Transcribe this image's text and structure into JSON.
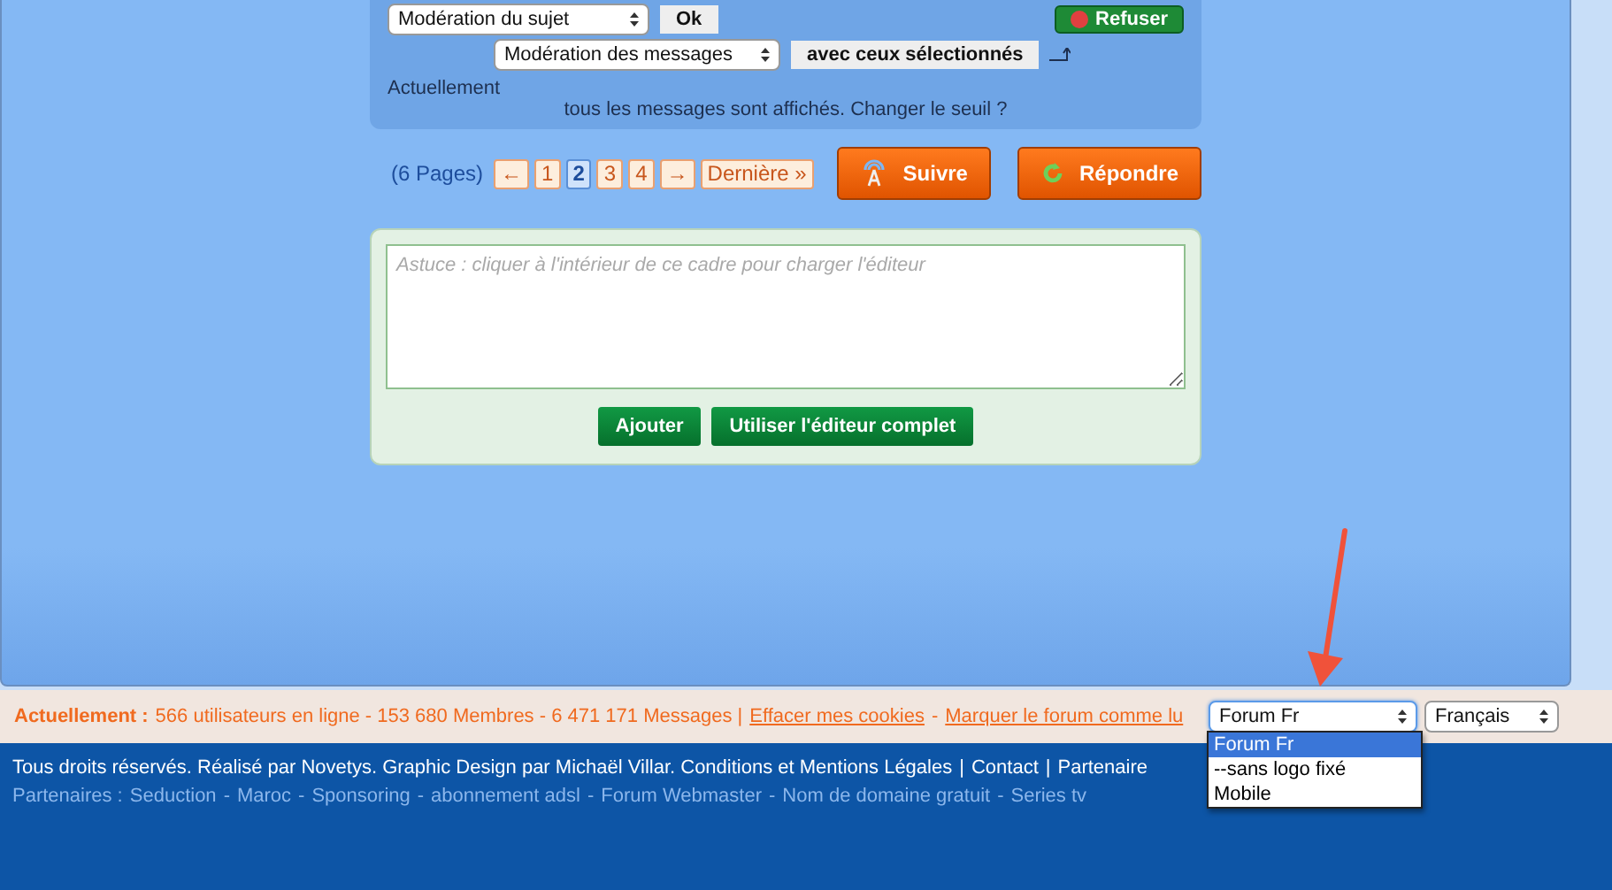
{
  "moderation": {
    "topic_select": "Modération du sujet",
    "ok": "Ok",
    "messages_select": "Modération des messages",
    "selected_action": "avec ceux sélectionnés",
    "refuse": "Refuser",
    "status_label": "Actuellement",
    "status_text": "tous les messages sont affichés. Changer le seuil ?"
  },
  "pagination": {
    "label": "(6 Pages)",
    "items": [
      {
        "label": "←",
        "selected": false
      },
      {
        "label": "1",
        "selected": false
      },
      {
        "label": "2",
        "selected": true
      },
      {
        "label": "3",
        "selected": false
      },
      {
        "label": "4",
        "selected": false
      },
      {
        "label": "→",
        "selected": false
      },
      {
        "label": "Dernière »",
        "selected": false
      }
    ]
  },
  "actions": [
    {
      "kind": "follow",
      "label": "Suivre"
    },
    {
      "kind": "reply",
      "label": "Répondre"
    }
  ],
  "quick_reply": {
    "placeholder": "Astuce : cliquer à l'intérieur de ce cadre pour charger l'éditeur",
    "buttons": [
      "Ajouter",
      "Utiliser l'éditeur complet"
    ]
  },
  "online_bar": {
    "label": "Actuellement :",
    "stats": "566 utilisateurs en ligne - 153 680 Membres - 6 471 171 Messages |",
    "links": [
      "Effacer mes cookies",
      "Marquer le forum comme lu"
    ],
    "separator": "-",
    "skin_select": "Forum Fr",
    "skin_options": [
      {
        "label": "Forum Fr",
        "selected": true
      },
      {
        "label": "--sans logo fixé",
        "selected": false
      },
      {
        "label": "Mobile",
        "selected": false
      }
    ],
    "language_select": "Français"
  },
  "footer": {
    "credits": "Tous droits réservés. Réalisé par Novetys. Graphic Design par Michaël Villar. Conditions et Mentions Légales",
    "credit_links": [
      "Contact",
      "Partenaire"
    ],
    "credit_separator": "|",
    "partners_label": "Partenaires :",
    "partners": [
      "Seduction",
      "Maroc",
      "Sponsoring",
      "abonnement adsl",
      "Forum Webmaster",
      "Nom de domaine gratuit",
      "Series tv"
    ],
    "partners_separator": "-"
  }
}
